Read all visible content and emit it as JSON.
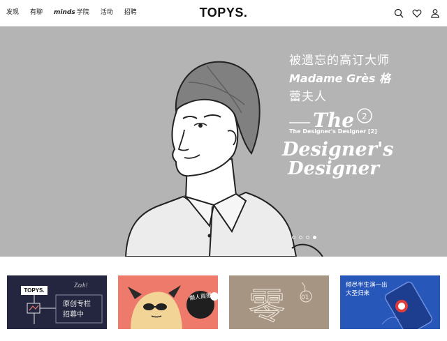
{
  "header": {
    "nav": [
      {
        "label": "发现"
      },
      {
        "label": "有聊"
      },
      {
        "label_em": "minds",
        "label": "学院"
      },
      {
        "label": "活动"
      },
      {
        "label": "招聘"
      }
    ],
    "logo": "TOPYS.",
    "icons": [
      "search-icon",
      "heart-icon",
      "user-icon"
    ]
  },
  "hero": {
    "title_line1": "被遗忘的高订大师",
    "title_line2": "Madame Grès 格",
    "title_line3": "蕾夫人",
    "artwork": {
      "top_word": "The",
      "badge": "2",
      "subtitle": "The Designer's Designer [2]",
      "word2": "Designer's",
      "word3": "Designer"
    },
    "dots": 4,
    "active_dot": 3
  },
  "cards": [
    {
      "logo": "TOPYS.",
      "tag": "Zzzh!",
      "line1": "原创专栏",
      "line2": "招募中"
    },
    {
      "label": "懒人周报"
    },
    {
      "char": "零",
      "num": "01"
    },
    {
      "line1": "倾尽半生演一出",
      "line2": "大圣归来"
    }
  ],
  "colors": {
    "hero_bg": "#b4b4b4",
    "card1": "#24253f",
    "card2": "#ee7a6b",
    "card3": "#a79584",
    "card4": "#2757b8"
  }
}
